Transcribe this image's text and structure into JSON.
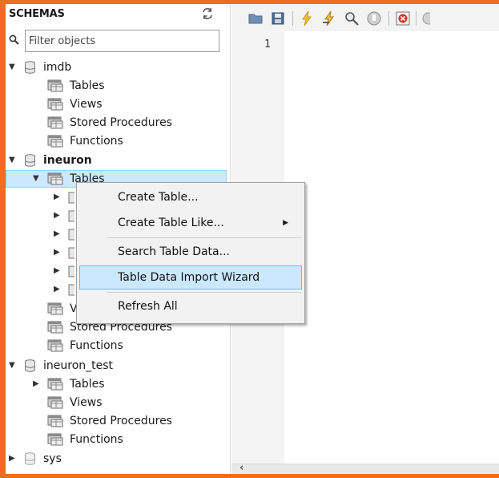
{
  "sidebar": {
    "title": "SCHEMAS",
    "filter_placeholder": "Filter objects",
    "schemas": [
      {
        "name": "imdb",
        "expanded": true,
        "children": [
          "Tables",
          "Views",
          "Stored Procedures",
          "Functions"
        ]
      },
      {
        "name": "ineuron",
        "expanded": true,
        "bold": true,
        "children": [
          "Tables",
          "V",
          "Stored Procedures",
          "Functions"
        ]
      },
      {
        "name": "ineuron_test",
        "expanded": true,
        "children": [
          "Tables",
          "Views",
          "Stored Procedures",
          "Functions"
        ]
      },
      {
        "name": "sys",
        "expanded": false,
        "children": []
      }
    ]
  },
  "editor": {
    "line_number": "1"
  },
  "context_menu": {
    "items": [
      {
        "label": "Create Table...",
        "submenu": false
      },
      {
        "label": "Create Table Like...",
        "submenu": true
      },
      {
        "label": "Search Table Data...",
        "submenu": false
      },
      {
        "label": "Table Data Import Wizard",
        "submenu": false,
        "highlighted": true
      },
      {
        "label": "Refresh All",
        "submenu": false
      }
    ]
  },
  "toolbar": {
    "icons": [
      "open-folder-icon",
      "save-icon",
      "execute-lightning-icon",
      "execute-current-icon",
      "explain-magnifier-icon",
      "stop-icon",
      "toggle-error-icon",
      "circle-icon"
    ]
  },
  "colors": {
    "frame": "#ec6e22",
    "selection": "#cce8ff",
    "menu_bg": "#f2f2f2"
  }
}
